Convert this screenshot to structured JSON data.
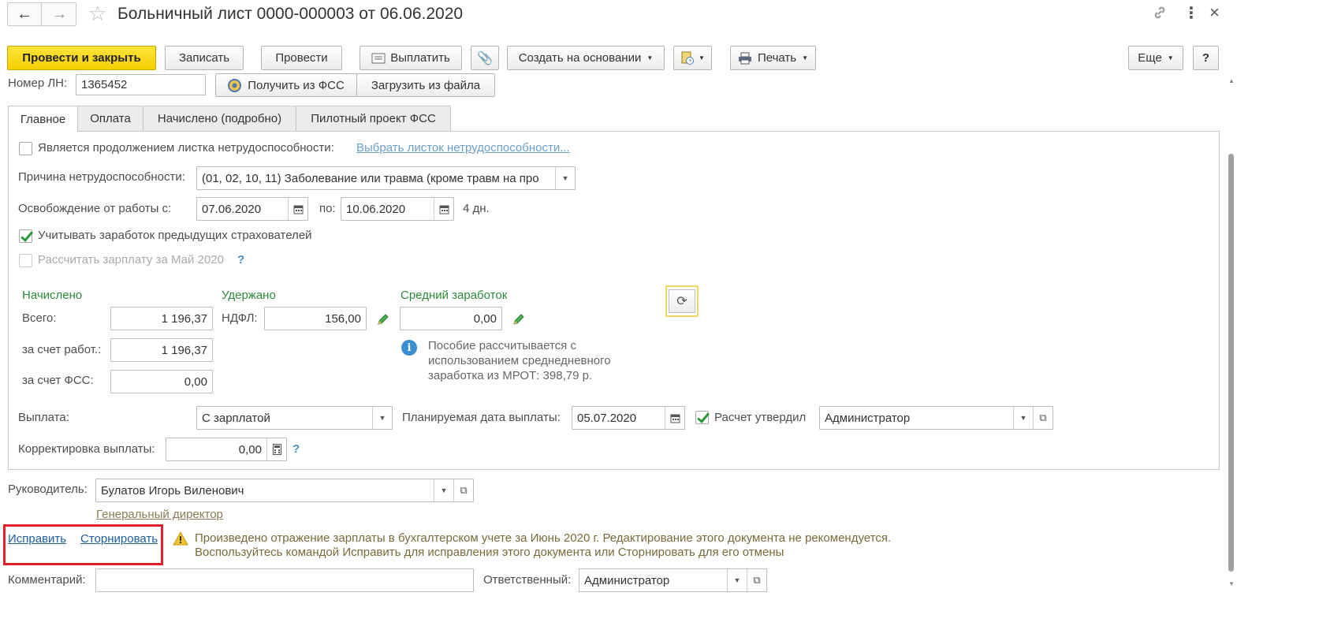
{
  "header": {
    "title": "Больничный лист 0000-000003 от 06.06.2020",
    "back_icon": "arrow-left-icon",
    "forward_icon": "arrow-right-icon",
    "star_icon": "star-icon"
  },
  "toolbar": {
    "post_and_close": "Провести и закрыть",
    "save": "Записать",
    "post": "Провести",
    "pay": "Выплатить",
    "create_based_on": "Создать на основании",
    "print": "Печать",
    "more": "Еще",
    "help": "?"
  },
  "ln": {
    "label": "Номер ЛН:",
    "value": "1365452",
    "get_from_fss": "Получить из ФСС",
    "load_from_file": "Загрузить из файла"
  },
  "tabs": [
    "Главное",
    "Оплата",
    "Начислено (подробно)",
    "Пилотный проект ФСС"
  ],
  "main": {
    "continuation_label": "Является продолжением листка нетрудоспособности:",
    "continuation_link": "Выбрать листок нетрудоспособности...",
    "reason_label": "Причина нетрудоспособности:",
    "reason_value": "(01, 02, 10, 11) Заболевание или травма (кроме травм на про",
    "release_label": "Освобождение от работы с:",
    "date_from": "07.06.2020",
    "to_label": "по:",
    "date_to": "10.06.2020",
    "days": "4 дн.",
    "prev_insurers_label": "Учитывать заработок предыдущих страхователей",
    "calc_salary_label": "Рассчитать зарплату за Май 2020",
    "calc_help": "?"
  },
  "amounts": {
    "accrued_header": "Начислено",
    "withheld_header": "Удержано",
    "avg_header": "Средний заработок",
    "total_label": "Всего:",
    "total_value": "1 196,37",
    "employer_label": "за счет работ.:",
    "employer_value": "1 196,37",
    "fss_label": "за счет ФСС:",
    "fss_value": "0,00",
    "ndfl_label": "НДФЛ:",
    "ndfl_value": "156,00",
    "avg_value": "0,00",
    "info_text_1": "Пособие рассчитывается с",
    "info_text_2": "использованием среднедневного",
    "info_text_3": "заработка из МРОТ: 398,79 р."
  },
  "payment": {
    "label": "Выплата:",
    "value": "С зарплатой",
    "planned_date_label": "Планируемая дата выплаты:",
    "planned_date": "05.07.2020",
    "approved_label": "Расчет утвердил",
    "approved_by": "Администратор",
    "correction_label": "Корректировка выплаты:",
    "correction_value": "0,00",
    "correction_help": "?"
  },
  "footer": {
    "manager_label": "Руководитель:",
    "manager_value": "Булатов Игорь Виленович",
    "manager_position": "Генеральный директор",
    "fix_link": "Исправить",
    "reverse_link": "Сторнировать",
    "warning_1": "Произведено отражение зарплаты в бухгалтерском учете за Июнь 2020 г. Редактирование этого документа не рекомендуется.",
    "warning_2": "Воспользуйтесь командой Исправить для исправления этого документа или Сторнировать для его отмены",
    "comment_label": "Комментарий:",
    "comment_value": "",
    "responsible_label": "Ответственный:",
    "responsible_value": "Администратор"
  },
  "colors": {
    "primary_button": "#f5d000",
    "section_header_green": "#2e8b3a",
    "link_blue": "#6a9fc8",
    "highlight_red": "#e0202a"
  }
}
